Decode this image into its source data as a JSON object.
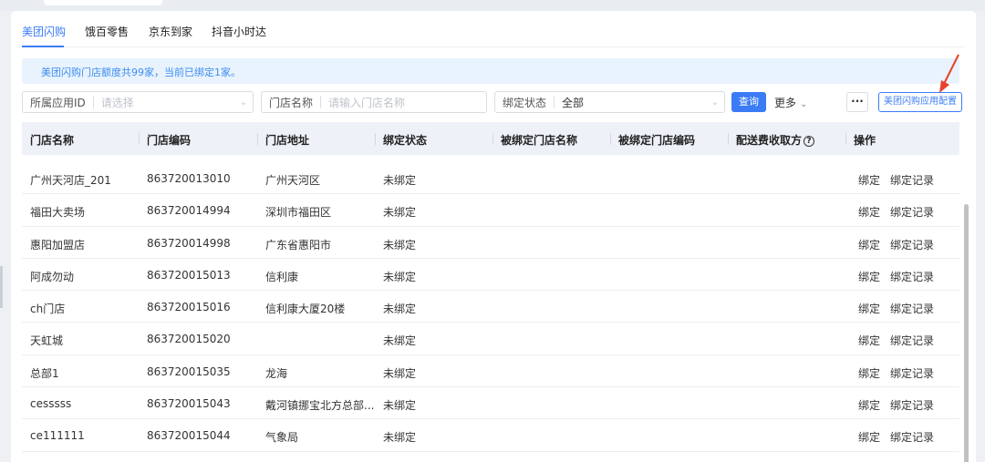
{
  "tabs": [
    {
      "label": "美团闪购",
      "active": true
    },
    {
      "label": "饿百零售",
      "active": false
    },
    {
      "label": "京东到家",
      "active": false
    },
    {
      "label": "抖音小时达",
      "active": false
    }
  ],
  "notice": "美团闪购门店额度共99家，当前已绑定1家。",
  "filters": {
    "app": {
      "label": "所属应用ID",
      "placeholder": "请选择"
    },
    "store_name": {
      "label": "门店名称",
      "placeholder": "请输入门店名称"
    },
    "bind_status": {
      "label": "绑定状态",
      "value": "全部"
    }
  },
  "buttons": {
    "query": "查询",
    "more": "更多",
    "dots": "···",
    "config": "美团闪购应用配置"
  },
  "columns": [
    "门店名称",
    "门店编码",
    "门店地址",
    "绑定状态",
    "被绑定门店名称",
    "被绑定门店编码",
    "配送费收取方",
    "操作"
  ],
  "rows": [
    {
      "name": "广州天河店_201",
      "code": "863720013010",
      "address": "广州天河区",
      "status": "未绑定",
      "bound_name": "",
      "bound_code": "",
      "delivery": ""
    },
    {
      "name": "福田大卖场",
      "code": "863720014994",
      "address": "深圳市福田区",
      "status": "未绑定",
      "bound_name": "",
      "bound_code": "",
      "delivery": ""
    },
    {
      "name": "惠阳加盟店",
      "code": "863720014998",
      "address": "广东省惠阳市",
      "status": "未绑定",
      "bound_name": "",
      "bound_code": "",
      "delivery": ""
    },
    {
      "name": "阿成勿动",
      "code": "863720015013",
      "address": "信利康",
      "status": "未绑定",
      "bound_name": "",
      "bound_code": "",
      "delivery": ""
    },
    {
      "name": "ch门店",
      "code": "863720015016",
      "address": "信利康大厦20楼",
      "status": "未绑定",
      "bound_name": "",
      "bound_code": "",
      "delivery": ""
    },
    {
      "name": "天虹城",
      "code": "863720015020",
      "address": "",
      "status": "未绑定",
      "bound_name": "",
      "bound_code": "",
      "delivery": ""
    },
    {
      "name": "总部1",
      "code": "863720015035",
      "address": "龙海",
      "status": "未绑定",
      "bound_name": "",
      "bound_code": "",
      "delivery": ""
    },
    {
      "name": "cesssss",
      "code": "863720015043",
      "address": "戴河镇挪宝北方总部...",
      "status": "未绑定",
      "bound_name": "",
      "bound_code": "",
      "delivery": ""
    },
    {
      "name": "ce111111",
      "code": "863720015044",
      "address": "气象局",
      "status": "未绑定",
      "bound_name": "",
      "bound_code": "",
      "delivery": ""
    }
  ],
  "row_actions": {
    "bind": "绑定",
    "bind_record": "绑定记录"
  },
  "colors": {
    "accent": "#3b7cf5",
    "arrow": "#e8412c",
    "notice_bg": "#e8f3fd",
    "header_bg": "#eef2f8"
  }
}
